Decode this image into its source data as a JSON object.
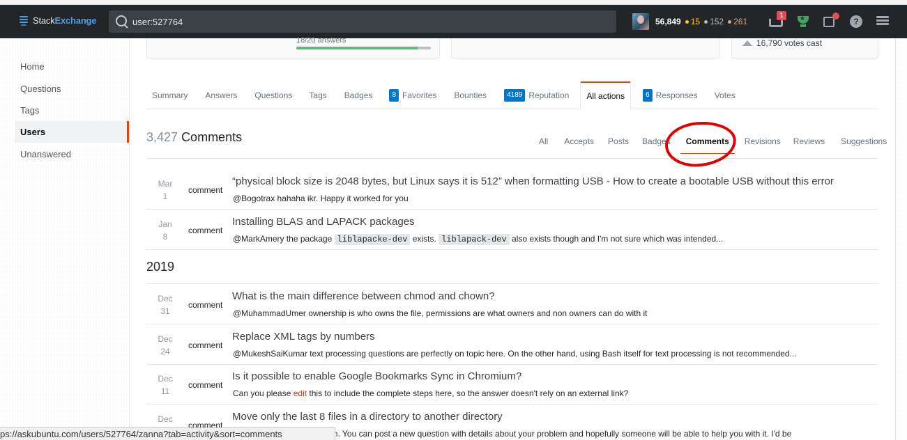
{
  "topbar": {
    "logo_stack": "Stack",
    "logo_exchange": "Exchange",
    "search_value": "user:527764",
    "reputation": "56,849",
    "gold": "15",
    "silver": "152",
    "bronze": "261",
    "inbox_count": "1",
    "help_glyph": "?"
  },
  "sidebar": {
    "items": [
      {
        "label": "Home"
      },
      {
        "label": "Questions"
      },
      {
        "label": "Tags"
      },
      {
        "label": "Users"
      },
      {
        "label": "Unanswered"
      }
    ]
  },
  "stats": {
    "answers_label": "18/20 answers",
    "answers_progress": 0.9,
    "votes_cast": "16,790 votes cast"
  },
  "tabs": [
    {
      "label": "Summary"
    },
    {
      "label": "Answers"
    },
    {
      "label": "Questions"
    },
    {
      "label": "Tags"
    },
    {
      "label": "Badges"
    },
    {
      "label": "Favorites",
      "count": "8"
    },
    {
      "label": "Bounties"
    },
    {
      "label": "Reputation",
      "count": "4189"
    },
    {
      "label": "All actions"
    },
    {
      "label": "Responses",
      "count": "6"
    },
    {
      "label": "Votes"
    }
  ],
  "heading": {
    "count": "3,427",
    "label": "Comments"
  },
  "subtabs": [
    {
      "label": "All"
    },
    {
      "label": "Accepts"
    },
    {
      "label": "Posts"
    },
    {
      "label": "Badges"
    },
    {
      "label": "Comments"
    },
    {
      "label": "Revisions"
    },
    {
      "label": "Reviews"
    },
    {
      "label": "Suggestions"
    }
  ],
  "year_heading": "2019",
  "items": [
    {
      "month": "Mar",
      "day": "1",
      "type": "comment",
      "title": "“physical block size is 2048 bytes, but Linux says it is 512” when formatting USB - How to create a bootable USB without this error",
      "body_parts": [
        "@Bogotrax hahaha ikr. Happy it worked for you"
      ]
    },
    {
      "month": "Jan",
      "day": "8",
      "type": "comment",
      "title": "Installing BLAS and LAPACK packages",
      "body_parts": [
        "@MarkAmery the package ",
        "liblapacke-dev",
        " exists. ",
        "liblapack-dev",
        " also exists though and I'm not sure which was intended..."
      ]
    },
    {
      "month": "Dec",
      "day": "31",
      "type": "comment",
      "title": "What is the main difference between chmod and chown?",
      "body_parts": [
        "@MuhammadUmer ownership is who owns the file, permissions are what owners and non owners can do with it"
      ]
    },
    {
      "month": "Dec",
      "day": "24",
      "type": "comment",
      "title": "Replace XML tags by numbers",
      "body_parts": [
        "@MukeshSaiKumar text processing questions are perfectly on topic here. On the other hand, using Bash itself for text processing is not recommended..."
      ]
    },
    {
      "month": "Dec",
      "day": "11",
      "type": "comment",
      "title": "Is it possible to enable Google Bookmarks Sync in Chromium?",
      "body_parts": [
        "Can you please ",
        "edit",
        " this to include the complete steps here, so the answer doesn't rely on an external link?"
      ]
    },
    {
      "month": "Dec",
      "day": "",
      "type": "comment",
      "title": "Move only the last 8 files in a directory to another directory",
      "body_parts": [
        "@Pl... that shouldn't happen. You can post a new question with details about your problem and hopefully someone will be able to help you with it. I'd be"
      ]
    }
  ],
  "statusbar": "ps://askubuntu.com/users/527764/zanna?tab=activity&sort=comments"
}
